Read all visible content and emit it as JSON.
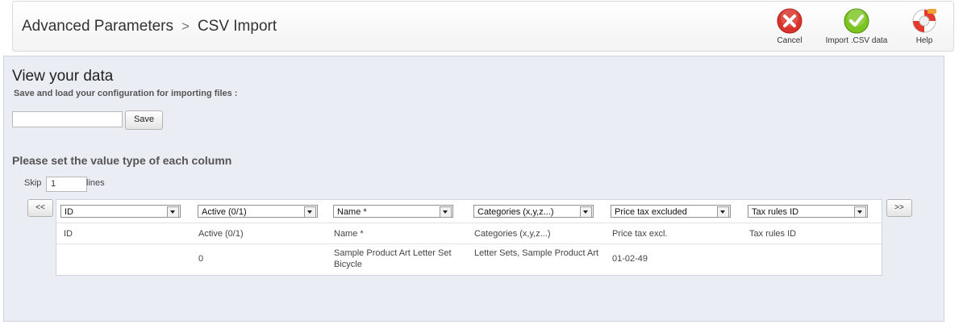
{
  "breadcrumb": {
    "parent": "Advanced Parameters",
    "separator": ">",
    "current": "CSV Import"
  },
  "toolbar": {
    "cancel_label": "Cancel",
    "import_label": "Import .CSV data",
    "help_label": "Help",
    "icons": {
      "cancel": "cancel-icon",
      "import": "check-icon",
      "help": "lifebuoy-icon"
    },
    "colors": {
      "cancel": "#d9342b",
      "import": "#7cc420",
      "help": "#e23b2e"
    }
  },
  "panel": {
    "title": "View your data",
    "subtitle": "Save and load your configuration for importing files :",
    "config_input_value": "",
    "save_label": "Save",
    "section_title": "Please set the value type of each column",
    "skip_label": "Skip",
    "skip_value": "1",
    "lines_label": "lines",
    "prev_label": "<<",
    "next_label": ">>"
  },
  "table": {
    "column_types": [
      "ID",
      "Active (0/1)",
      "Name *",
      "Categories (x,y,z...)",
      "Price tax excluded",
      "Tax rules ID"
    ],
    "headers": [
      "ID",
      "Active (0/1)",
      "Name *",
      "Categories (x,y,z...)",
      "Price tax excl.",
      "Tax rules ID"
    ],
    "rows": [
      [
        "",
        "0",
        "Sample Product Art Letter Set Bicycle",
        "Letter Sets, Sample Product Art",
        "01-02-49",
        ""
      ]
    ]
  }
}
